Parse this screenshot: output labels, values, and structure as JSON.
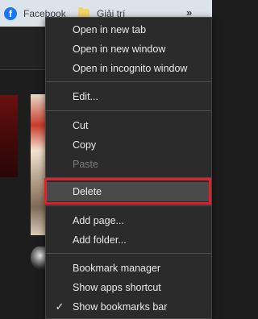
{
  "bookmarks_bar": {
    "items": [
      {
        "label": "Facebook",
        "icon": "facebook-icon",
        "icon_glyph": "f",
        "color": "#1877f2"
      },
      {
        "label": "Giải trí",
        "icon": "folder-icon",
        "color": "#f6d36a"
      }
    ],
    "more": "»"
  },
  "context_menu": {
    "items": [
      {
        "label": "Open in new tab"
      },
      {
        "label": "Open in new window"
      },
      {
        "label": "Open in incognito window"
      },
      {
        "label": "Edit..."
      },
      {
        "label": "Cut"
      },
      {
        "label": "Copy"
      },
      {
        "label": "Paste",
        "disabled": true
      },
      {
        "label": "Delete",
        "highlighted": true
      },
      {
        "label": "Add page..."
      },
      {
        "label": "Add folder..."
      },
      {
        "label": "Bookmark manager"
      },
      {
        "label": "Show apps shortcut"
      },
      {
        "label": "Show bookmarks bar",
        "checked": true
      }
    ],
    "check_glyph": "✓",
    "highlight_color": "#e0202b"
  }
}
